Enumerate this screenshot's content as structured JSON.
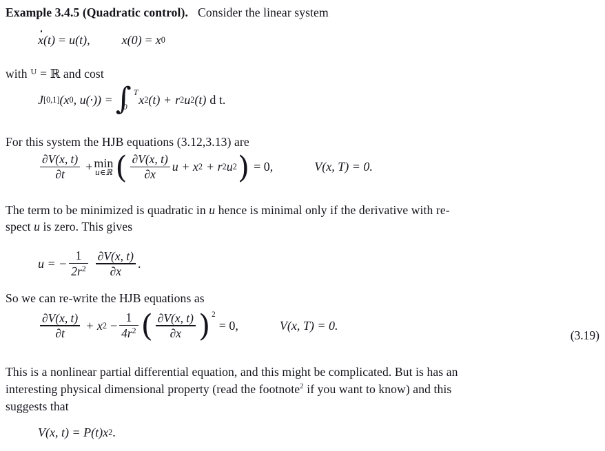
{
  "document": {
    "type": "textbook-excerpt",
    "background_color": "#ffffff",
    "text_color": "#13131b"
  },
  "example": {
    "heading_bold": "Example 3.4.5 (Quadratic control).",
    "heading_rest": "Consider the linear system"
  },
  "equations": {
    "system": {
      "lhs_dot_var": "x",
      "lhs_arg": "(t)",
      "equals": "=",
      "rhs": "u(t),",
      "initial_lhs": "x(0)",
      "initial_equals": "=",
      "initial_rhs_base": "x",
      "initial_rhs_sub": "0"
    },
    "cost": {
      "J": "J",
      "J_sub": "[0,1]",
      "args": "(x",
      "args_sub": "0",
      "args_rest": ", u(·)) =",
      "integral_upper": "T",
      "integral_lower": "0",
      "integrand_a": "x",
      "integrand_a_sup": "2",
      "integrand_a_arg": "(t) +",
      "integrand_b": "r",
      "integrand_b_sup": "2",
      "integrand_c": "u",
      "integrand_c_sup": "2",
      "integrand_c_arg": "(t)",
      "differential": "d t."
    },
    "hjb": {
      "frac1_num": "∂V(x, t)",
      "frac1_den": "∂t",
      "plus": "+",
      "min_label": "min",
      "min_sub": "u∈ℝ",
      "frac2_num": "∂V(x, t)",
      "frac2_den": "∂x",
      "after_frac2": "u + x",
      "after_frac2_sup": "2",
      "plus2": "+ r",
      "r_sup": "2",
      "u_term": "u",
      "u_term_sup": "2",
      "equals_zero": "= 0,",
      "terminal": "V(x, T) = 0."
    },
    "optimal_u": {
      "lhs": "u = −",
      "frac1_num": "1",
      "frac1_den_base": "2r",
      "frac1_den_sup": "2",
      "frac2_num": "∂V(x, t)",
      "frac2_den": "∂x",
      "period": "."
    },
    "rewritten": {
      "frac1_num": "∂V(x, t)",
      "frac1_den": "∂t",
      "plus_x": "+ x",
      "plus_x_sup": "2",
      "minus": "−",
      "frac2_num": "1",
      "frac2_den_base": "4r",
      "frac2_den_sup": "2",
      "frac3_num": "∂V(x, t)",
      "frac3_den": "∂x",
      "paren_sup": "2",
      "equals_zero": "= 0,",
      "terminal": "V(x, T) = 0.",
      "number": "(3.19)"
    },
    "ansatz": {
      "lhs": "V(x, t) = P(t)x",
      "sup": "2",
      "period": "."
    }
  },
  "paragraphs": {
    "with_cost_pre": "with ",
    "with_cost_U": "ᵁ",
    "with_cost_mid": " = ",
    "with_cost_R": "ℝ",
    "with_cost_post": " and cost",
    "for_this_system": "For this system the HJB equations (3.12,3.13) are",
    "minimized_line1": "The term to be minimized is quadratic in ",
    "minimized_u": "u",
    "minimized_line1b": " hence is minimal only if the derivative with re-",
    "minimized_line2a": "spect ",
    "minimized_u2": "u",
    "minimized_line2b": " is zero. This gives",
    "rewrite_intro": "So we can re-write the HJB equations as",
    "nonlinear_a": "This is a nonlinear partial differential equation, and this might be complicated. But is has an",
    "nonlinear_b1": "interesting physical dimensional property (read the footnote",
    "nonlinear_b_sup": "2",
    "nonlinear_b2": " if you want to know) and this",
    "nonlinear_c": "suggests that"
  }
}
